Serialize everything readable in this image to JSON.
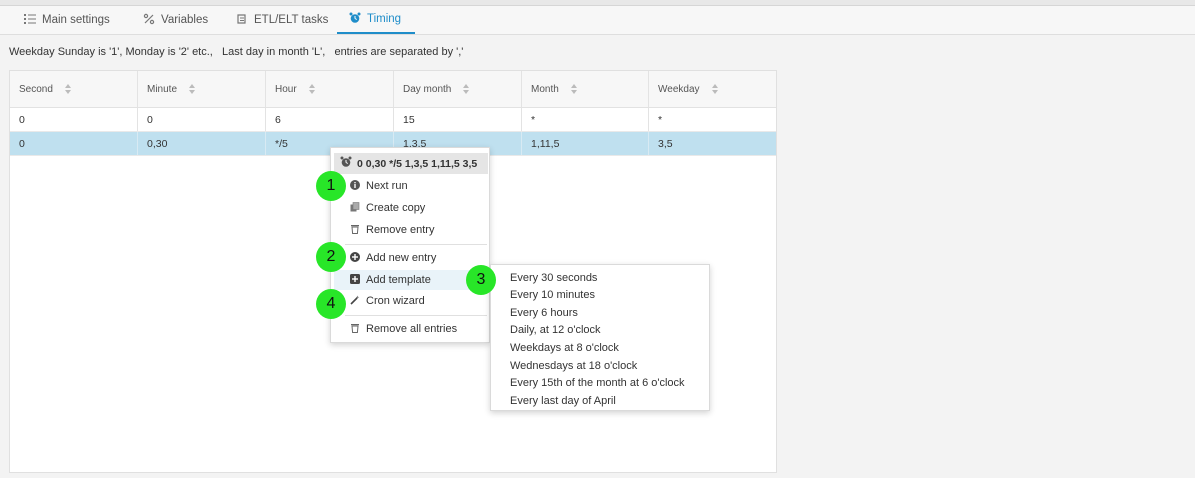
{
  "tabs": [
    {
      "label": "Main settings",
      "icon": "list-icon"
    },
    {
      "label": "Variables",
      "icon": "percent-icon"
    },
    {
      "label": "ETL/ELT tasks",
      "icon": "scroll-icon"
    },
    {
      "label": "Timing",
      "icon": "alarm-clock-icon",
      "active": true
    }
  ],
  "hint": "Weekday Sunday is '1', Monday is '2' etc.,   Last day in month 'L',   entries are separated by ','",
  "grid": {
    "columns": [
      "Second",
      "Minute",
      "Hour",
      "Day month",
      "Month",
      "Weekday"
    ],
    "rows": [
      [
        "0",
        "0",
        "6",
        "15",
        "*",
        "*"
      ],
      [
        "0",
        "0,30",
        "*/5",
        "1,3,5",
        "1,11,5",
        "3,5"
      ]
    ],
    "selected_row": 1
  },
  "context_menu": {
    "header": "0 0,30 */5 1,3,5 1,11,5 3,5",
    "items": {
      "next_run": "Next run",
      "create_copy": "Create copy",
      "remove_entry": "Remove entry",
      "add_new_entry": "Add new entry",
      "add_template": "Add template",
      "cron_wizard": "Cron wizard",
      "remove_all": "Remove all entries"
    }
  },
  "template_submenu": [
    "Every 30 seconds",
    "Every 10 minutes",
    "Every 6 hours",
    "Daily, at 12 o'clock",
    "Weekdays at 8 o'clock",
    "Wednesdays at 18 o'clock",
    "Every 15th of the month at 6 o'clock",
    "Every last day of April"
  ],
  "badges": [
    "1",
    "2",
    "3",
    "4"
  ],
  "colors": {
    "accent": "#1f8dc9",
    "selected_row": "#bfe0ef",
    "badge": "#28e628"
  }
}
